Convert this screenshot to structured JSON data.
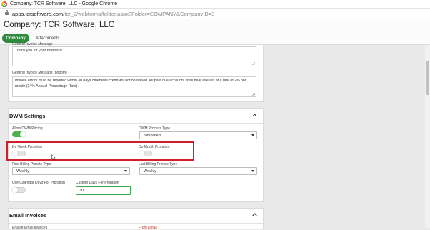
{
  "browser": {
    "window_title": "Company: TCR Software, LLC - Google Chrome",
    "url_host": "apps.tcrsoftware.com",
    "url_path": "/tcr_2/webforms/folder.aspx?Folder=COMPANY&CompanyID=3"
  },
  "page": {
    "title": "Company: TCR Software, LLC",
    "tabs": [
      {
        "label": "Company",
        "active": true
      },
      {
        "label": "Attachments",
        "active": false
      }
    ]
  },
  "invoice_messages": {
    "top_label_partial": "General Invoice Message",
    "top_value": "Thank you for your business!",
    "bottom_label": "General Invoice Message (bottom)",
    "bottom_value": "Invoice errors must be reported within 30 days otherwise credit will not be issued.  All past due accounts shall bear interest at a rate of 2% per month (24% Annual Percentage Rate)."
  },
  "dwm_settings": {
    "title": "DWM Settings",
    "allow_pricing_label": "Allow DWM Pricing",
    "allow_pricing_on": true,
    "process_type_label": "DWM Process Type",
    "process_type_value": "Simplified",
    "week_proration_label": "Do Week Proration",
    "week_proration_on": false,
    "month_proration_label": "Do Month Proration",
    "month_proration_on": false,
    "first_prorate_label": "First Billing Prorate Type",
    "first_prorate_value": "Weekly",
    "last_prorate_label": "Last Billing Prorate Type",
    "last_prorate_value": "Weekly",
    "calendar_days_label": "Use Calendar Days For Proration",
    "calendar_days_on": false,
    "custom_days_label": "Custom Days For Proration",
    "custom_days_value": "30"
  },
  "email_invoices": {
    "title": "Email Invoices",
    "enable_label_partial": "Enable Email Invoices",
    "from_label_partial": "From Email"
  },
  "colors": {
    "accent_green": "#2e8b3b",
    "highlight_red": "#d01f2a"
  }
}
